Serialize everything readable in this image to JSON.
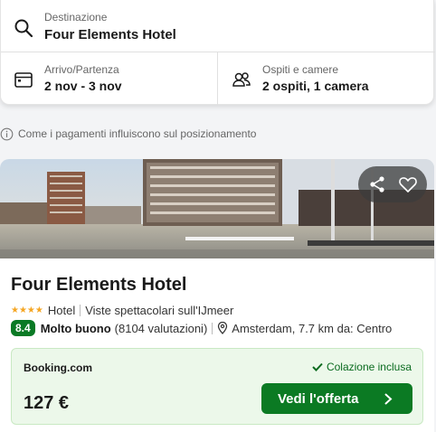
{
  "search": {
    "destination_label": "Destinazione",
    "destination_value": "Four Elements Hotel",
    "dates_label": "Arrivo/Partenza",
    "dates_value": "2 nov - 3 nov",
    "guests_label": "Ospiti e camere",
    "guests_value": "2 ospiti, 1 camera",
    "icons": [
      "search-icon",
      "calendar-icon",
      "people-icon"
    ]
  },
  "info": {
    "text": "Come i pagamenti influiscono sul posizionamento",
    "icon": "info-icon"
  },
  "hotel": {
    "name": "Four Elements Hotel",
    "stars": 4,
    "stars_text": "★★★★",
    "type": "Hotel",
    "tagline": "Viste spettacolari sull'IJmeer",
    "score": "8.4",
    "rating_label": "Molto buono",
    "reviews": "(8104 valutazioni)",
    "location": "Amsterdam, 7.7 km da: Centro",
    "photo_actions": [
      "share-icon",
      "heart-icon"
    ]
  },
  "offer": {
    "provider": "Booking.com",
    "amenity": "Colazione inclusa",
    "price": "127 €",
    "cta_label": "Vedi l'offerta"
  },
  "colors": {
    "accent_green": "#0b7a23",
    "score_green": "#0a7a25",
    "offer_bg": "#ecf8ea",
    "star": "#f5a623"
  }
}
